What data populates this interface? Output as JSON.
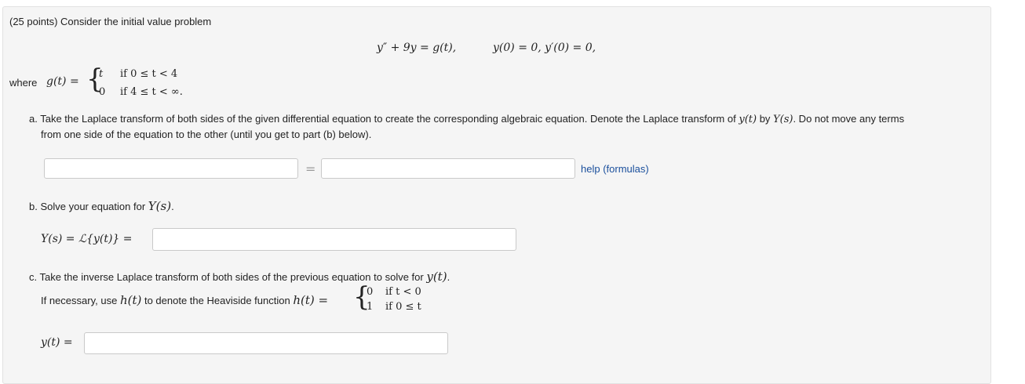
{
  "problem": {
    "header": "(25 points) Consider the initial value problem",
    "ode": "y″ + 9y = g(t),",
    "initial_conditions": "y(0) = 0,   y′(0) = 0,",
    "where_label": "where",
    "g_lhs": "g(t) =",
    "g_case1_value": "t",
    "g_case1_cond": "if 0 ≤ t < 4",
    "g_case2_value": "0",
    "g_case2_cond": "if 4 ≤ t < ∞."
  },
  "part_a": {
    "text_line1_prefix": "a. Take the Laplace transform of both sides of the given differential equation to create the corresponding algebraic equation. Denote the Laplace transform of",
    "text_y": "y(t)",
    "text_by": "by",
    "text_Y": "Y(s)",
    "text_line1_suffix": ". Do not move any terms",
    "text_line2": "from one side of the equation to the other (until you get to part (b) below).",
    "equals": "=",
    "lhs_value": "",
    "rhs_value": "",
    "help_link": "help (formulas)"
  },
  "part_b": {
    "text_prefix": "b. Solve your equation for",
    "text_Y": "Y(s)",
    "text_suffix": ".",
    "answer_label": "Y(s) = ℒ{y(t)} =",
    "answer_value": ""
  },
  "part_c": {
    "text_prefix": "c. Take the inverse Laplace transform of both sides of the previous equation to solve for",
    "text_y": "y(t)",
    "text_suffix": ".",
    "heaviside_prefix": "If necessary, use",
    "heaviside_h": "h(t)",
    "heaviside_middle": "to denote the Heaviside function",
    "heaviside_lhs": "h(t) =",
    "h_case1_value": "0",
    "h_case1_cond": "if t < 0",
    "h_case2_value": "1",
    "h_case2_cond": "if 0 ≤ t",
    "answer_label": "y(t) =",
    "answer_value": ""
  }
}
